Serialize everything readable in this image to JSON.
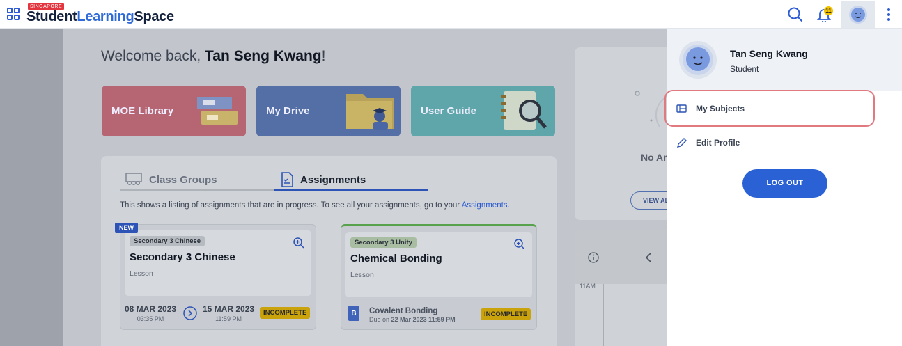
{
  "header": {
    "logo_tag": "SINGAPORE",
    "logo_word1": "Student",
    "logo_word2": "Learning",
    "logo_word3": "Space",
    "notification_count": "11",
    "icons": [
      "apps-icon",
      "search-icon",
      "bell-icon",
      "avatar",
      "more-vertical-icon"
    ]
  },
  "welcome": {
    "prefix": "Welcome back, ",
    "name": "Tan Seng Kwang",
    "suffix": "!"
  },
  "tiles": [
    {
      "label": "MOE Library",
      "color": "#b66572"
    },
    {
      "label": "My Drive",
      "color": "#536fa6"
    },
    {
      "label": "User Guide",
      "color": "#5fa6aa"
    }
  ],
  "tabs": {
    "class_groups": "Class Groups",
    "assignments": "Assignments"
  },
  "description": {
    "text": "This shows a listing of assignments that are in progress. To see all your assignments, go to your ",
    "link": "Assignments",
    "end": "."
  },
  "cards": [
    {
      "badge": "NEW",
      "pill": "Secondary 3 Chinese",
      "title": "Secondary 3 Chinese",
      "type": "Lesson",
      "start_date": "08 MAR 2023",
      "start_time": "03:35 PM",
      "end_date": "15 MAR 2023",
      "end_time": "11:59 PM",
      "status": "INCOMPLETE"
    },
    {
      "pill": "Secondary 3 Unity",
      "title": "Chemical Bonding",
      "type": "Lesson",
      "resource_title": "Covalent Bonding",
      "due_prefix": "Due on ",
      "due_date": "22 Mar 2023 11:59 PM",
      "file_letter": "B",
      "status": "INCOMPLETE"
    }
  ],
  "side_card": {
    "text": "No Ar",
    "button": "VIEW AL"
  },
  "calendar": {
    "time": "11AM"
  },
  "dropdown": {
    "name": "Tan Seng Kwang",
    "role": "Student",
    "items": [
      "My Subjects",
      "Edit Profile"
    ],
    "logout": "LOG OUT"
  },
  "colors": {
    "accent": "#2a62d6",
    "highlight": "#e07a80",
    "status": "#f4c400"
  }
}
